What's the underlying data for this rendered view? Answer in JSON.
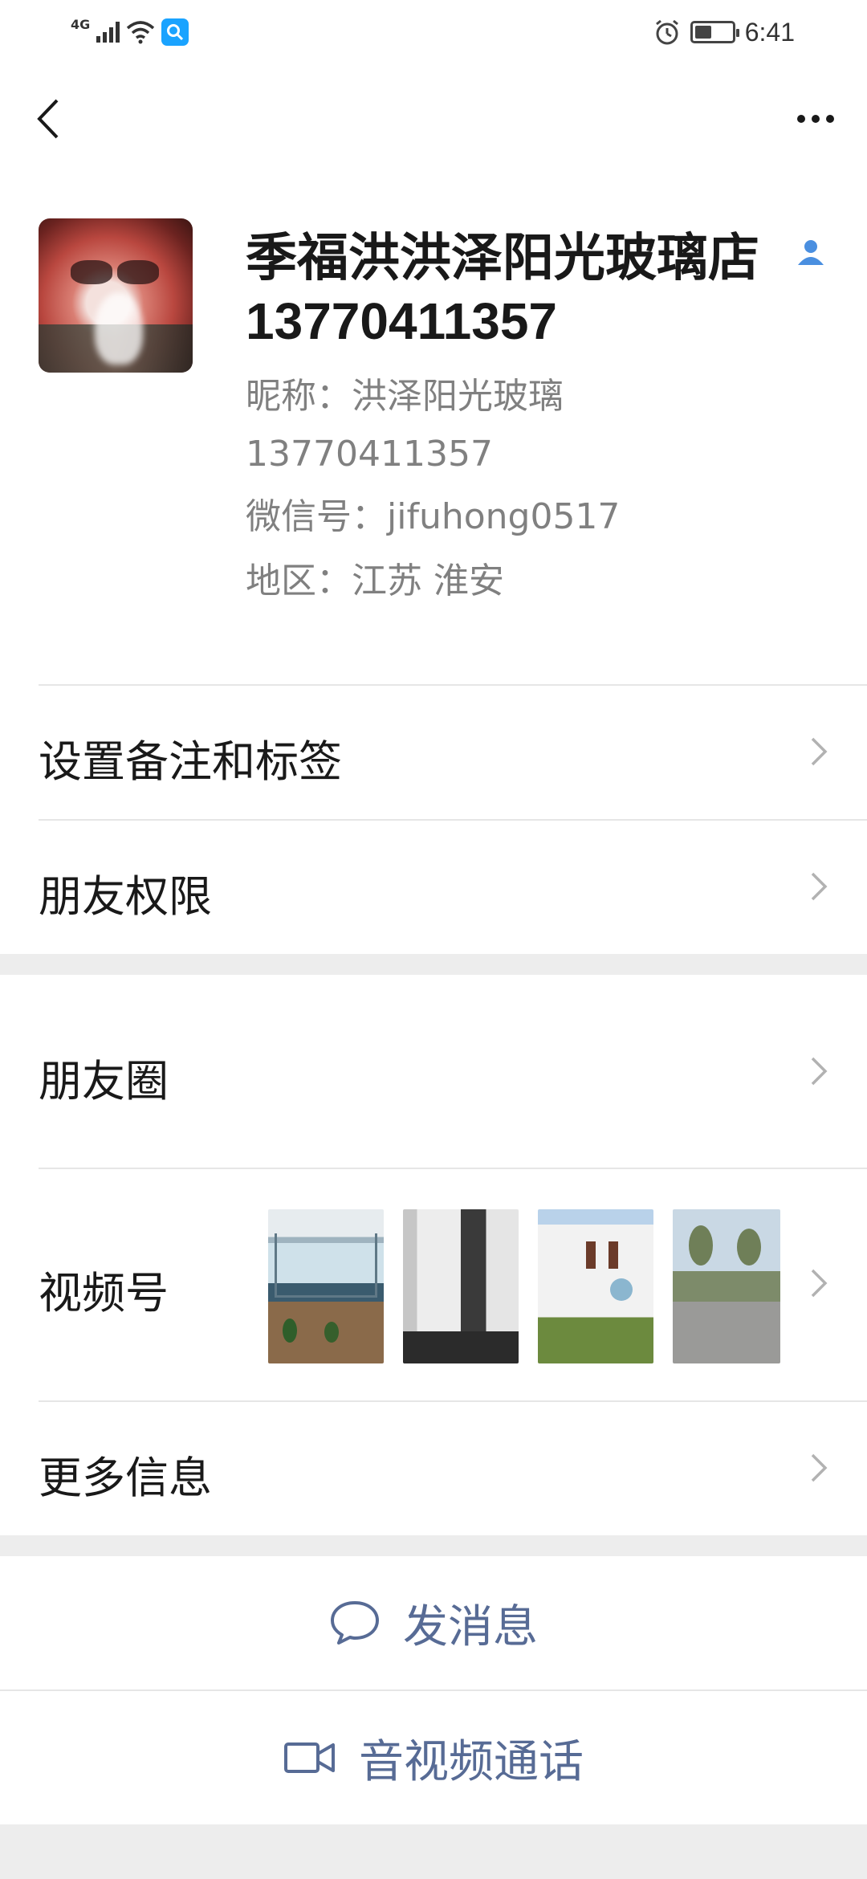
{
  "status_bar": {
    "network": "4G",
    "time": "6:41",
    "battery_level": 0.45
  },
  "profile": {
    "name": "季福洪洪泽阳光玻璃店",
    "phone_line": "13770411357",
    "nickname": "昵称：洪泽阳光玻璃",
    "nickname_phone": "13770411357",
    "wechat_id": "微信号：jifuhong0517",
    "region": "地区：江苏  淮安"
  },
  "menu": {
    "remark_tags": "设置备注和标签",
    "friend_permissions": "朋友权限",
    "moments": "朋友圈",
    "channels": "视频号",
    "more_info": "更多信息"
  },
  "actions": {
    "send_message": "发消息",
    "av_call": "音视频通话"
  },
  "colors": {
    "link_blue": "#576b95",
    "background_gray": "#ededed",
    "chevron_gray": "#b2b2b2",
    "verify_blue": "#4a8fe0"
  },
  "icons": {
    "back": "chevron-left-icon",
    "more": "ellipsis-icon",
    "verify": "person-icon",
    "chat": "speech-bubble-icon",
    "video": "video-camera-icon"
  }
}
